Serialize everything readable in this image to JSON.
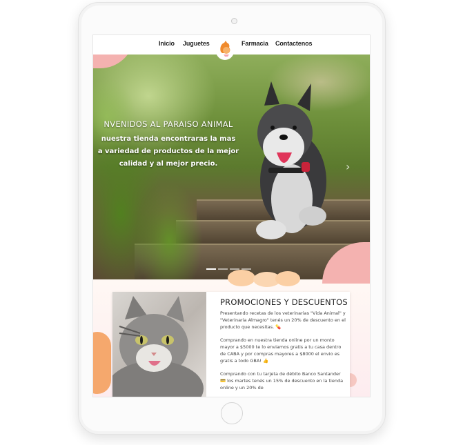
{
  "nav": {
    "items": [
      "Inicio",
      "Juguetes",
      "Farmacia",
      "Contactenos"
    ],
    "logo_icon": "dog-and-cat-logo-icon"
  },
  "hero": {
    "title": "NVENIDOS AL PARAISO ANIMAL",
    "subtitle_lines": [
      "nuestra tienda encontraras la mas",
      "a variedad de productos de la mejor",
      "calidad y al mejor precio."
    ],
    "next_icon": "chevron-right-icon",
    "slides_total": 4,
    "slide_active": 1
  },
  "promo": {
    "title": "PROMOCIONES Y DESCUENTOS",
    "paragraphs": [
      "Presentando recetas de los veterinarias \"Vida Animal\" y \"Veterinaria Almagro\" tenés un 20% de descuento en el producto que necesitas. 💊",
      "Comprando en nuestra tienda online por un monto mayor a $5000 te lo enviamos gratis a tu casa dentro de CABA y por compras mayores a $8000 el envio es gratis a todo GBA! 👍",
      "Comprando con tu tarjeta de débito Banco Santander 💳 los martes tenés un 15% de descuento en la tienda online y un 20% de"
    ]
  },
  "colors": {
    "accent_pink": "#f4b2b0",
    "accent_orange": "#f5a86d"
  }
}
